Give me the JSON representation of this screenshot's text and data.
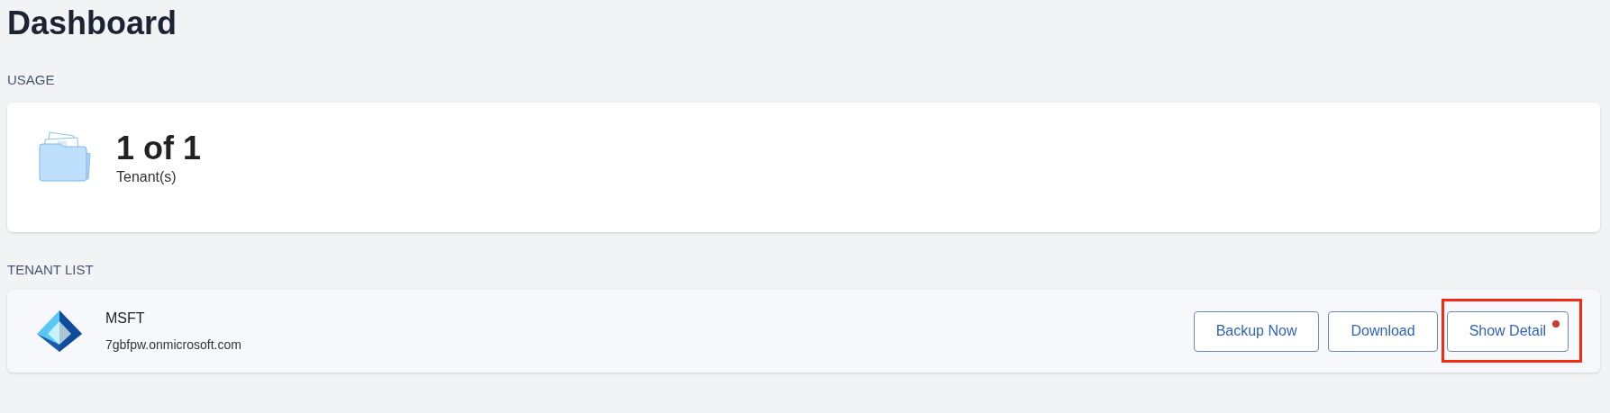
{
  "page": {
    "title": "Dashboard"
  },
  "usage": {
    "heading": "USAGE",
    "value": "1 of 1",
    "label": "Tenant(s)"
  },
  "tenant_list": {
    "heading": "TENANT LIST",
    "tenants": [
      {
        "name": "MSFT",
        "domain": "7gbfpw.onmicrosoft.com",
        "actions": [
          {
            "label": "Backup Now",
            "highlighted": false,
            "notification": false
          },
          {
            "label": "Download",
            "highlighted": false,
            "notification": false
          },
          {
            "label": "Show Detail",
            "highlighted": true,
            "notification": true
          }
        ]
      }
    ]
  }
}
